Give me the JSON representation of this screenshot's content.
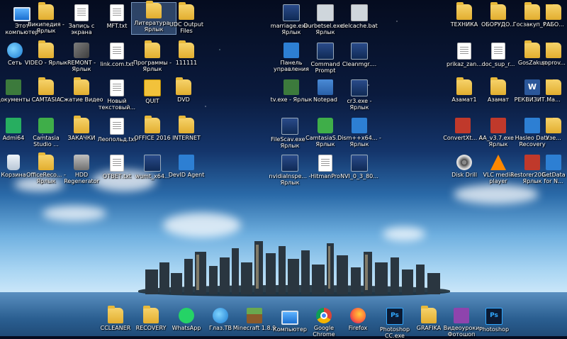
{
  "desktop": {
    "icons": [
      {
        "label": "Этот компьютер",
        "icon": "monitor-icon"
      },
      {
        "label": "Сеть",
        "icon": "network-icon"
      },
      {
        "label": "документы",
        "icon": "documents-icon"
      },
      {
        "label": "Admi64",
        "icon": "admin-icon"
      },
      {
        "label": "Корзина",
        "icon": "recycle-bin-icon"
      },
      {
        "label": "Википедия - Ярлык",
        "icon": "folder-shortcut-icon"
      },
      {
        "label": "VIDEO - Ярлык",
        "icon": "folder-shortcut-icon"
      },
      {
        "label": "CAMTASIA",
        "icon": "folder-icon"
      },
      {
        "label": "Camtasia Studio ...",
        "icon": "camtasia-icon"
      },
      {
        "label": "OfficeReco... - Ярлык",
        "icon": "folder-shortcut-icon"
      },
      {
        "label": "Запись с экрана",
        "icon": "document-icon"
      },
      {
        "label": "REMONT - Ярлык",
        "icon": "tool-icon"
      },
      {
        "label": "Сжатие Видео",
        "icon": "folder-icon"
      },
      {
        "label": "ЗАКАЧКИ",
        "icon": "folder-icon"
      },
      {
        "label": "HDD Regenerator",
        "icon": "hdd-icon"
      },
      {
        "label": "MFT.txt",
        "icon": "text-file-icon"
      },
      {
        "label": "link.com.txt",
        "icon": "text-file-icon"
      },
      {
        "label": "Новый текстовый...",
        "icon": "text-file-icon"
      },
      {
        "label": "Леопольд.txt",
        "icon": "text-file-icon"
      },
      {
        "label": "ОТВЕТ.txt",
        "icon": "text-file-icon"
      },
      {
        "label": "Литература - Ярлык",
        "icon": "folder-shortcut-icon"
      },
      {
        "label": "Программы - Ярлык",
        "icon": "folder-shortcut-icon"
      },
      {
        "label": "QUIT",
        "icon": "quit-icon"
      },
      {
        "label": "OFFICE 2016",
        "icon": "folder-icon"
      },
      {
        "label": "wumt_x64...",
        "icon": "exe-icon"
      },
      {
        "label": "UDC Output Files",
        "icon": "folder-icon"
      },
      {
        "label": "111111",
        "icon": "folder-icon"
      },
      {
        "label": "DVD",
        "icon": "folder-icon"
      },
      {
        "label": "INTERNET",
        "icon": "folder-icon"
      },
      {
        "label": "DevID Agent",
        "icon": "devid-icon"
      },
      {
        "label": "marriage.exe - Ярлык",
        "icon": "exe-icon"
      },
      {
        "label": "Панель управления",
        "icon": "control-panel-icon"
      },
      {
        "label": "tv.exe - Ярлык",
        "icon": "film-icon"
      },
      {
        "label": "FileScav.exe - Ярлык",
        "icon": "exe-icon"
      },
      {
        "label": "nvidiaInspe... - Ярлык",
        "icon": "exe-icon"
      },
      {
        "label": "Durbetsel.exe - Ярлык",
        "icon": "exe-icon"
      },
      {
        "label": "Command Prompt",
        "icon": "cmd-icon"
      },
      {
        "label": "Notepad",
        "icon": "notepad-icon"
      },
      {
        "label": "CamtasiaS... - Ярлык",
        "icon": "camtasia-icon"
      },
      {
        "label": "HitmanPro",
        "icon": "text-file-icon"
      },
      {
        "label": "delcache.bat",
        "icon": "bat-icon"
      },
      {
        "label": "Cleanmgr....",
        "icon": "exe-icon"
      },
      {
        "label": "cr3.exe - Ярлык",
        "icon": "exe-icon"
      },
      {
        "label": "Dism++x64... - Ярлык",
        "icon": "exe-icon"
      },
      {
        "label": "NVI_0_3_80...",
        "icon": "exe-icon"
      },
      {
        "label": "ТЕХНИКА",
        "icon": "folder-icon"
      },
      {
        "label": "prikaz_zan...",
        "icon": "document-icon"
      },
      {
        "label": "Азамат1",
        "icon": "folder-icon"
      },
      {
        "label": "ConvertXt... 4",
        "icon": "exe-icon"
      },
      {
        "label": "Disk Drill",
        "icon": "disk-icon"
      },
      {
        "label": "ОБОРУДО...",
        "icon": "folder-icon"
      },
      {
        "label": "doc_sup_r...",
        "icon": "document-icon"
      },
      {
        "label": "Азамат",
        "icon": "folder-icon"
      },
      {
        "label": "AA_v3.7.exe - Ярлык",
        "icon": "exe-icon"
      },
      {
        "label": "VLC media player",
        "icon": "vlc-icon"
      },
      {
        "label": "Госзакуп_т...",
        "icon": "folder-icon"
      },
      {
        "label": "GosZakup",
        "icon": "folder-icon"
      },
      {
        "label": "РЕКВИЗИТ...",
        "icon": "word-icon"
      },
      {
        "label": "Hasleo Data Recovery",
        "icon": "exe-icon"
      },
      {
        "label": "Restorer200... - Ярлык",
        "icon": "exe-icon"
      },
      {
        "label": "РАБО...",
        "icon": "folder-icon"
      },
      {
        "label": "soprov...",
        "icon": "folder-icon"
      },
      {
        "label": "Ма...",
        "icon": "folder-icon"
      },
      {
        "label": "Узе...",
        "icon": "folder-icon"
      },
      {
        "label": "GetData for N...",
        "icon": "exe-icon"
      }
    ],
    "bottom_icons": [
      {
        "label": "CCLEANER",
        "icon": "folder-icon"
      },
      {
        "label": "RECOVERY",
        "icon": "folder-icon"
      },
      {
        "label": "WhatsApp",
        "icon": "whatsapp-icon"
      },
      {
        "label": "Глаз.ТВ",
        "icon": "glaz-tv-icon"
      },
      {
        "label": "Minecraft 1.8.9",
        "icon": "minecraft-icon"
      },
      {
        "label": "Компьютер",
        "icon": "monitor-icon"
      },
      {
        "label": "Google Chrome",
        "icon": "chrome-icon"
      },
      {
        "label": "Firefox",
        "icon": "firefox-icon"
      },
      {
        "label": "Photoshop CC.exe",
        "icon": "photoshop-icon"
      },
      {
        "label": "GRAFIKA",
        "icon": "folder-icon"
      },
      {
        "label": "Видеоуроки Фотошоп",
        "icon": "video-tutorial-icon"
      },
      {
        "label": "Photoshop",
        "icon": "photoshop-icon"
      }
    ]
  }
}
